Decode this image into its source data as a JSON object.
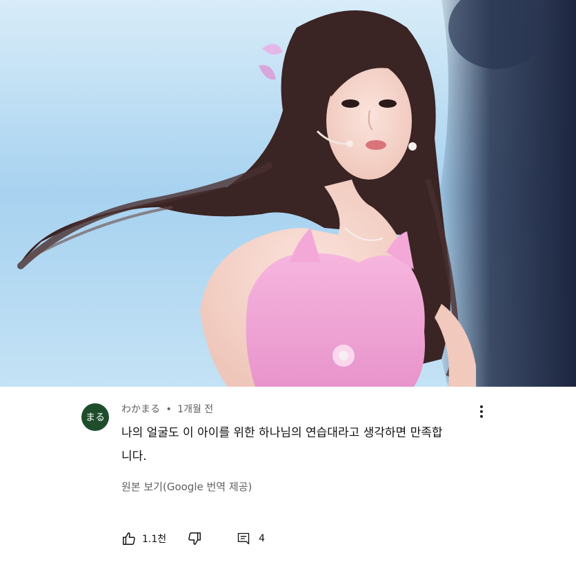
{
  "comment": {
    "avatar_text": "まる",
    "author": "わかまる",
    "separator": "•",
    "time": "1개월 전",
    "text": "나의 얼굴도 이 아이를 위한 하나님의 연습대라고 생각하면 만족합니다.",
    "translate_link": "원본 보기(Google 번역 제공)",
    "like_count": "1.1천",
    "reply_count": "4"
  },
  "icons": {
    "like": "thumbs-up-icon",
    "dislike": "thumbs-down-icon",
    "reply": "comment-icon",
    "more": "more-vert-icon"
  },
  "colors": {
    "avatar_bg": "#1f4d2c",
    "meta_text": "#606060",
    "body_text": "#0f0f0f",
    "photo_sky": "#a9d4f1",
    "dress": "#f2a6d6",
    "hair": "#3a2424"
  }
}
